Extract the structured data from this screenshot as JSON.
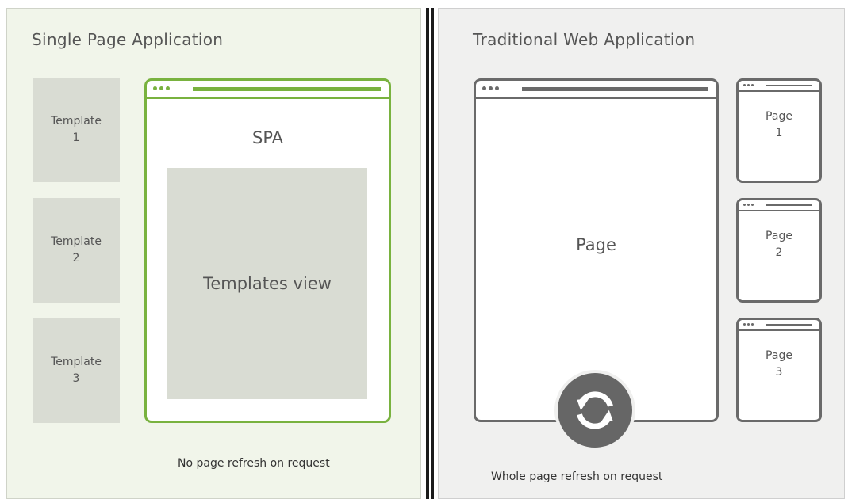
{
  "spa": {
    "title": "Single Page Application",
    "templates": [
      {
        "label": "Template\n1"
      },
      {
        "label": "Template\n2"
      },
      {
        "label": "Template\n3"
      }
    ],
    "window_label": "SPA",
    "view_label": "Templates view",
    "caption": "No page refresh on request",
    "accent_color": "#79b23f"
  },
  "traditional": {
    "title": "Traditional Web Application",
    "main_page_label": "Page",
    "pages": [
      {
        "label": "Page\n1"
      },
      {
        "label": "Page\n2"
      },
      {
        "label": "Page\n3"
      }
    ],
    "refresh_icon": "refresh-icon",
    "caption": "Whole page refresh on request",
    "outline_color": "#6a6a6a"
  }
}
